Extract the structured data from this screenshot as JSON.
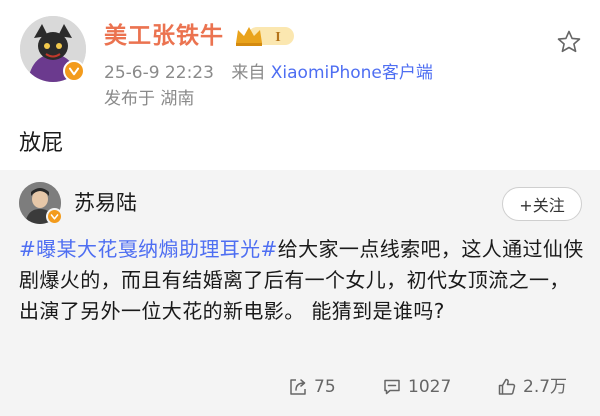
{
  "post": {
    "author": "美工张铁牛",
    "badge_level": "I",
    "timestamp": "25-6-9 22:23",
    "source_prefix": "来自",
    "client": "XiaomiPhone客户端",
    "location": "发布于 湖南",
    "text": "放屁"
  },
  "repost": {
    "author": "苏易陆",
    "follow_label": "+关注",
    "hashtag": "#曝某大花戛纳煽助理耳光#",
    "text": "给大家一点线索吧，这人通过仙侠剧爆火的，而且有结婚离了后有一个女儿，初代女顶流之一，出演了另外一位大花的新电影。 能猜到是谁吗?",
    "stats": {
      "reposts": "75",
      "comments": "1027",
      "likes": "2.7万"
    }
  },
  "colors": {
    "author_name": "#eb7350",
    "link": "#4e6ef2",
    "meta": "#8a8a8a",
    "repost_bg": "#f4f4f4",
    "verified_badge": "#f39b1c"
  },
  "icons": [
    "star-icon",
    "crown-icon",
    "verified-icon",
    "share-icon",
    "comment-icon",
    "like-icon"
  ]
}
